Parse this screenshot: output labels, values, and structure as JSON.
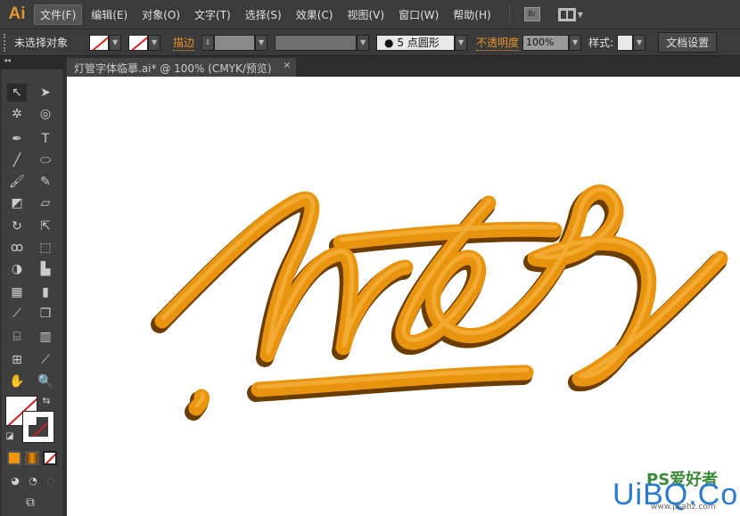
{
  "app": {
    "logo": "Ai"
  },
  "menu": [
    {
      "label": "文件(F)",
      "active": true
    },
    {
      "label": "编辑(E)"
    },
    {
      "label": "对象(O)"
    },
    {
      "label": "文字(T)"
    },
    {
      "label": "选择(S)"
    },
    {
      "label": "效果(C)"
    },
    {
      "label": "视图(V)"
    },
    {
      "label": "窗口(W)"
    },
    {
      "label": "帮助(H)"
    }
  ],
  "menu_icons": {
    "bridge": "Br",
    "workspace": "workspace-layout-icon"
  },
  "control": {
    "selection": "未选择对象",
    "stroke_label": "描边",
    "brush": "5 点圆形",
    "opacity_label": "不透明度",
    "opacity": "100%",
    "style_label": "样式:",
    "doc_settings": "文档设置"
  },
  "document_tab": {
    "title": "灯管字体临摹.ai* @ 100% (CMYK/预览)",
    "close": "×"
  },
  "colors": {
    "accent": "#e8922a",
    "tube": "#e8940e",
    "tube_shadow": "#7a4a05"
  },
  "watermark": {
    "text": "UiBQ.CoM",
    "sub": "PS爱好者",
    "url": "www.psahz.com"
  }
}
